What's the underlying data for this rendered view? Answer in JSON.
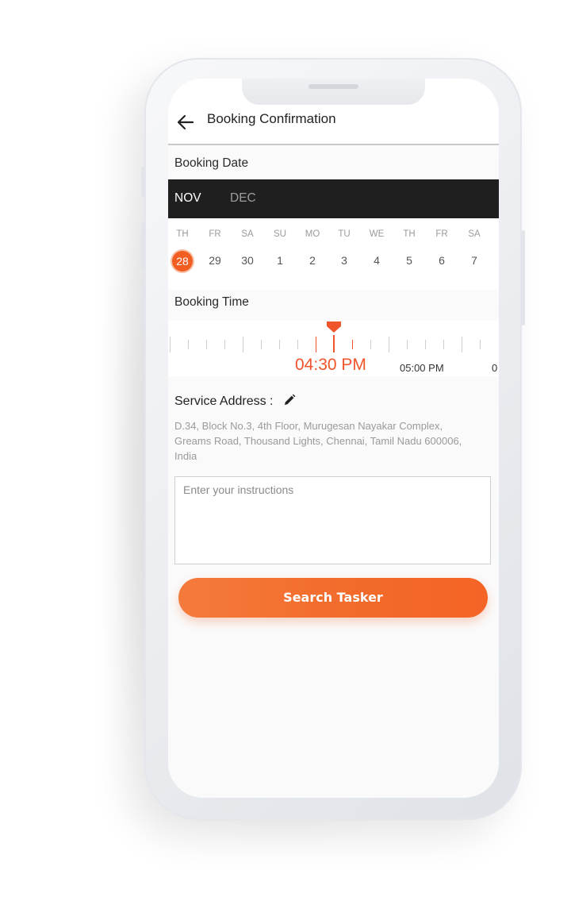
{
  "colors": {
    "accent": "#f25d22",
    "dark_bar": "#1f1f1f",
    "muted": "#9a9a9a"
  },
  "header": {
    "title": "Booking Confirmation",
    "back_icon": "arrow-left-icon"
  },
  "booking_date": {
    "label": "Booking Date",
    "months": [
      "NOV",
      "DEC"
    ],
    "selected_month": "NOV",
    "days": [
      {
        "name": "TH",
        "num": "28"
      },
      {
        "name": "FR",
        "num": "29"
      },
      {
        "name": "SA",
        "num": "30"
      },
      {
        "name": "SU",
        "num": "1"
      },
      {
        "name": "MO",
        "num": "2"
      },
      {
        "name": "TU",
        "num": "3"
      },
      {
        "name": "WE",
        "num": "4"
      },
      {
        "name": "TH",
        "num": "5"
      },
      {
        "name": "FR",
        "num": "6"
      },
      {
        "name": "SA",
        "num": "7"
      }
    ],
    "selected_day": "28"
  },
  "booking_time": {
    "label": "Booking Time",
    "selected": "04:30 PM",
    "next": "05:00 PM",
    "cut": "0"
  },
  "service_address": {
    "title": "Service Address :",
    "edit_icon": "pencil-icon",
    "text": "D.34, Block No.3, 4th Floor, Murugesan Nayakar Complex, Greams Road, Thousand Lights, Chennai, Tamil Nadu 600006, India"
  },
  "instructions": {
    "placeholder": "Enter your instructions"
  },
  "actions": {
    "search_label": "Search Tasker"
  }
}
